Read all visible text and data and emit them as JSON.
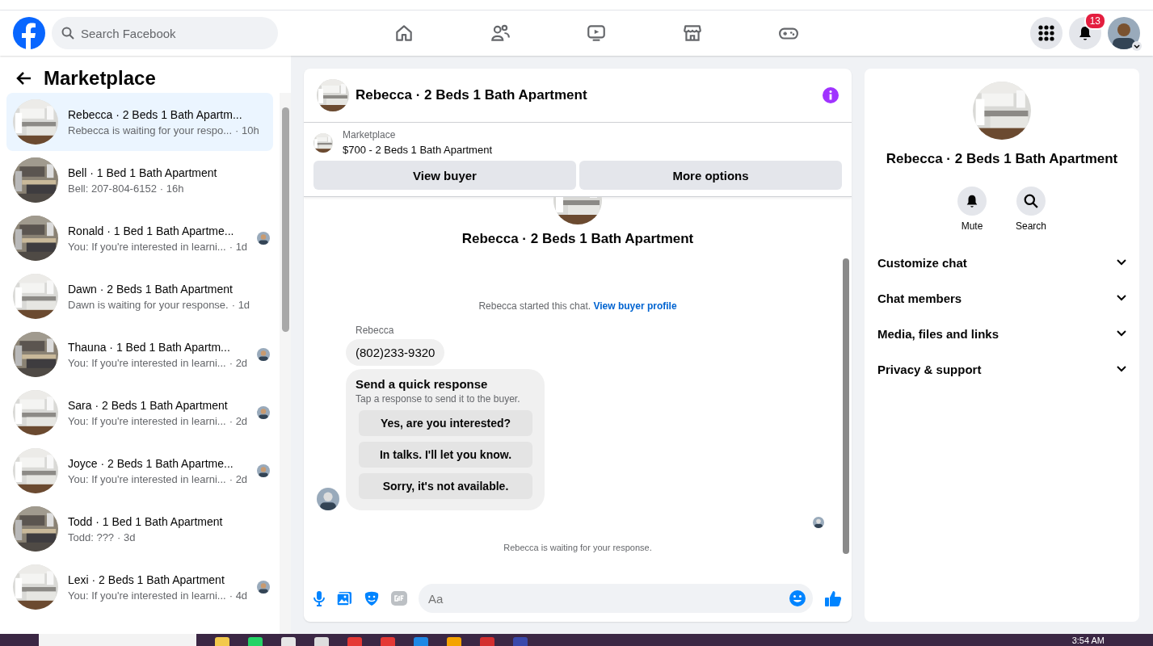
{
  "top_bar": {
    "search": {
      "placeholder": "Search Facebook"
    },
    "nav": [
      {
        "kind": "home"
      },
      {
        "kind": "friends"
      },
      {
        "kind": "watch"
      },
      {
        "kind": "marketplace"
      },
      {
        "kind": "gaming"
      }
    ],
    "notifications_badge": "13"
  },
  "sidebar": {
    "title": "Marketplace",
    "conversations": [
      {
        "title": "Rebecca · 2 Beds 1 Bath Apartm...",
        "preview": "Rebecca is waiting for your respo...",
        "time": "· 10h",
        "selected": true,
        "seen_avatar": false,
        "kind": "white"
      },
      {
        "title": "Bell · 1 Bed 1 Bath Apartment",
        "preview": "Bell: 207-804-6152",
        "time": "· 16h",
        "selected": false,
        "seen_avatar": false,
        "kind": "dark"
      },
      {
        "title": "Ronald · 1 Bed 1 Bath Apartme...",
        "preview": "You: If you're interested in learni...",
        "time": "· 1d",
        "selected": false,
        "seen_avatar": true,
        "kind": "dark"
      },
      {
        "title": "Dawn · 2 Beds 1 Bath Apartment",
        "preview": "Dawn is waiting for your response.",
        "time": "· 1d",
        "selected": false,
        "seen_avatar": false,
        "kind": "white"
      },
      {
        "title": "Thauna · 1 Bed 1 Bath Apartm...",
        "preview": "You: If you're interested in learni...",
        "time": "· 2d",
        "selected": false,
        "seen_avatar": true,
        "kind": "dark"
      },
      {
        "title": "Sara · 2 Beds 1 Bath Apartment",
        "preview": "You: If you're interested in learni...",
        "time": "· 2d",
        "selected": false,
        "seen_avatar": true,
        "kind": "white"
      },
      {
        "title": "Joyce · 2 Beds 1 Bath Apartme...",
        "preview": "You: If you're interested in learni...",
        "time": "· 2d",
        "selected": false,
        "seen_avatar": true,
        "kind": "white"
      },
      {
        "title": "Todd · 1 Bed 1 Bath Apartment",
        "preview": "Todd: ???",
        "time": "· 3d",
        "selected": false,
        "seen_avatar": false,
        "kind": "dark"
      },
      {
        "title": "Lexi · 2 Beds 1 Bath Apartment",
        "preview": "You: If you're interested in learni...",
        "time": "· 4d",
        "selected": false,
        "seen_avatar": true,
        "kind": "white"
      }
    ]
  },
  "chat": {
    "title": "Rebecca · 2 Beds 1 Bath Apartment",
    "listing_label": "Marketplace",
    "listing": "$700 - 2 Beds 1 Bath Apartment",
    "buttons": [
      "View buyer",
      "More options"
    ],
    "intro_title": "Rebecca · 2 Beds 1 Bath Apartment",
    "started": "Rebecca started this chat.",
    "profile_link": "View buyer profile",
    "sender": "Rebecca",
    "message": "(802)233-9320",
    "quick_title": "Send a quick response",
    "quick_hint": "Tap a response to send it to the buyer.",
    "quick_options": [
      "Yes, are you interested?",
      "In talks. I'll let you know.",
      "Sorry, it's not available."
    ],
    "waiting": "Rebecca is waiting for your response.",
    "composer": {
      "placeholder": "Aa"
    }
  },
  "details": {
    "title": "Rebecca · 2 Beds 1 Bath Apartment",
    "actions": [
      {
        "kind": "mute",
        "label": "Mute"
      },
      {
        "kind": "search",
        "label": "Search"
      }
    ],
    "sections": [
      {
        "label": "Customize chat",
        "expanded": false
      },
      {
        "label": "Chat members",
        "expanded": false
      },
      {
        "label": "Media, files and links",
        "expanded": false
      },
      {
        "label": "Privacy & support",
        "expanded": false
      }
    ]
  },
  "taskbar": {
    "clock": "3:54 AM"
  }
}
